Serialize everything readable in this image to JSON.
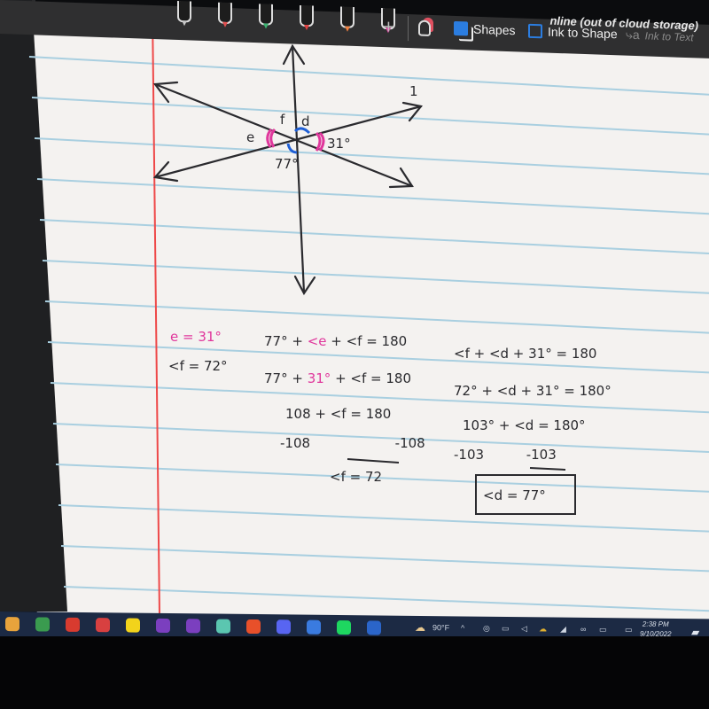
{
  "toolbar": {
    "title_fragment": "nline (out of cloud storage)",
    "pens": [
      {
        "name": "pen-1",
        "color": "#c8c8c8"
      },
      {
        "name": "pen-red",
        "color": "#e05050"
      },
      {
        "name": "pen-green",
        "color": "#3cb371"
      },
      {
        "name": "pen-black-red",
        "color": "#e04040"
      },
      {
        "name": "pen-black-orange",
        "color": "#f08040"
      },
      {
        "name": "pen-black-pink",
        "color": "#e040a0"
      }
    ],
    "add_pen_label": "+",
    "shapes_label": "Shapes",
    "ink_to_shape_label": "Ink to Shape",
    "ink_to_text_label": "Ink to Text"
  },
  "diagram": {
    "angle_labels": {
      "e": "e",
      "f": "f",
      "d": "d",
      "given_77": "77°",
      "given_31": "31°",
      "line_label": "1"
    },
    "colors": {
      "line": "#2a2a2e",
      "pink": "#e0379c",
      "blue": "#1f5fd6"
    }
  },
  "work": {
    "left_col": [
      {
        "text": "e = 31°",
        "color": "#e0379c"
      },
      {
        "text": "<f = 72°",
        "color": "#2a2a2e"
      }
    ],
    "middle_col": [
      {
        "parts": [
          {
            "t": "77° + ",
            "c": "#2a2a2e"
          },
          {
            "t": "<e",
            "c": "#e0379c"
          },
          {
            "t": " + <f = 180",
            "c": "#2a2a2e"
          }
        ]
      },
      {
        "parts": [
          {
            "t": "77° + ",
            "c": "#2a2a2e"
          },
          {
            "t": "31°",
            "c": "#e0379c"
          },
          {
            "t": " + <f = 180",
            "c": "#2a2a2e"
          }
        ]
      },
      {
        "parts": [
          {
            "t": "108 + <f = 180",
            "c": "#2a2a2e"
          }
        ]
      },
      {
        "parts": [
          {
            "t": "-108",
            "c": "#2a2a2e"
          },
          {
            "t": "          -108",
            "c": "#2a2a2e"
          }
        ]
      },
      {
        "parts": [
          {
            "t": "<f = 72",
            "c": "#2a2a2e"
          }
        ]
      }
    ],
    "right_col": [
      "<f + <d + 31° = 180",
      "72° + <d + 31° = 180°",
      "103° + <d = 180°",
      "-103          -103"
    ],
    "answer": "<d = 77°"
  },
  "taskbar": {
    "apps": [
      {
        "name": "microsoft-store",
        "color": "#e8a33c"
      },
      {
        "name": "chrome",
        "color": "#3a9b4f"
      },
      {
        "name": "office",
        "color": "#d83b2f"
      },
      {
        "name": "acrobat",
        "color": "#d84040"
      },
      {
        "name": "pacman-game",
        "color": "#f2d31b"
      },
      {
        "name": "onenote-1",
        "color": "#7b3fbf"
      },
      {
        "name": "onenote-2",
        "color": "#7b3fbf"
      },
      {
        "name": "app-teal",
        "color": "#5bc6b0"
      },
      {
        "name": "origin",
        "color": "#e8502a"
      },
      {
        "name": "discord",
        "color": "#5865f2"
      },
      {
        "name": "app-blue",
        "color": "#3a7be0"
      },
      {
        "name": "spotify",
        "color": "#1ed760"
      },
      {
        "name": "word",
        "color": "#2b65c9"
      }
    ],
    "weather": "90°F",
    "time": "2:38 PM",
    "date": "9/10/2022"
  }
}
